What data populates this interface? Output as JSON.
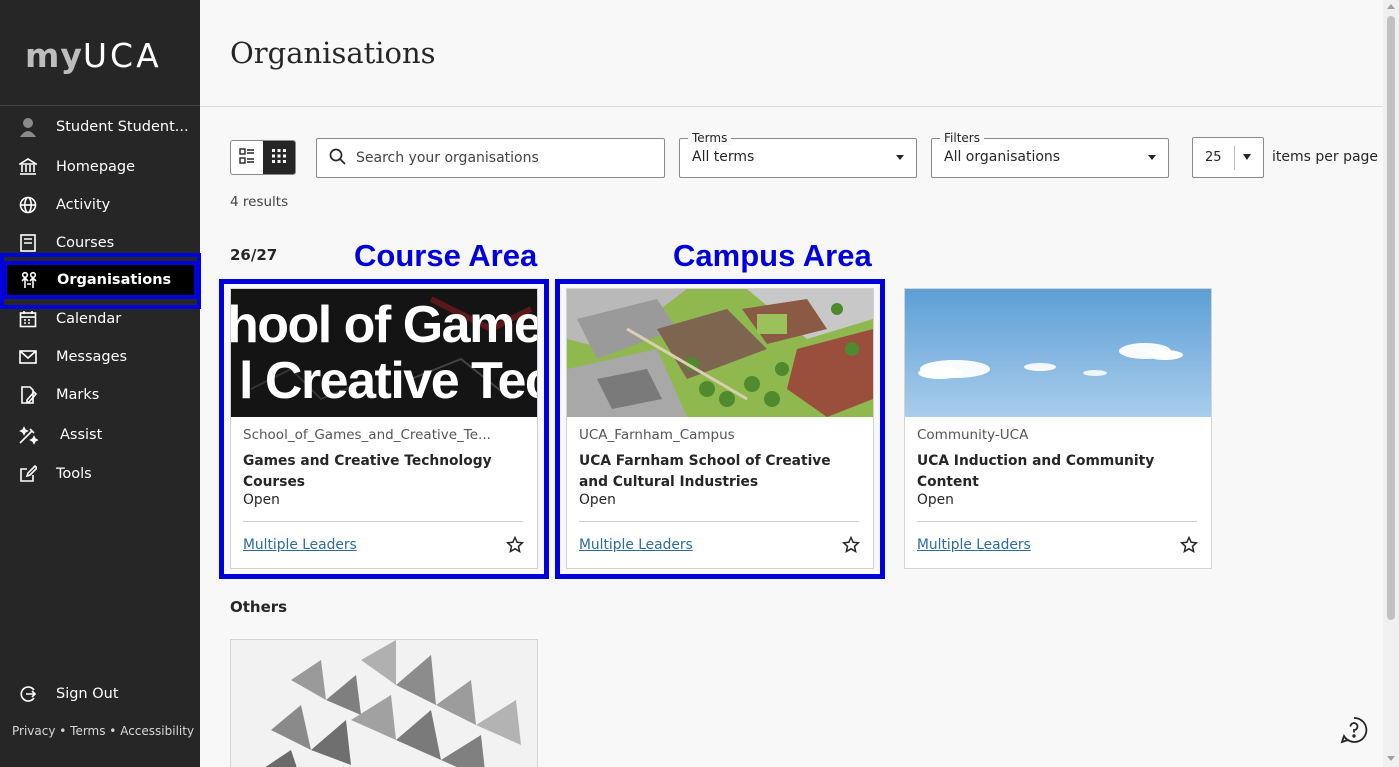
{
  "sidebar": {
    "logo_my": "my",
    "logo_uca": "UCA",
    "user_name": "Student Student...",
    "items": [
      {
        "label": "Homepage",
        "icon": "institution-icon"
      },
      {
        "label": "Activity",
        "icon": "globe-icon"
      },
      {
        "label": "Courses",
        "icon": "book-icon"
      },
      {
        "label": "Organisations",
        "icon": "people-icon",
        "active": true
      },
      {
        "label": "Calendar",
        "icon": "calendar-icon"
      },
      {
        "label": "Messages",
        "icon": "envelope-icon"
      },
      {
        "label": "Marks",
        "icon": "marks-icon"
      },
      {
        "label": "Assist",
        "icon": "assist-icon"
      },
      {
        "label": "Tools",
        "icon": "tools-icon"
      }
    ],
    "sign_out": "Sign Out",
    "footer": "Privacy • Terms • Accessibility"
  },
  "header": {
    "title": "Organisations"
  },
  "toolbar": {
    "search_placeholder": "Search your organisations",
    "terms_legend": "Terms",
    "terms_value": "All terms",
    "filters_legend": "Filters",
    "filters_value": "All organisations",
    "per_page_value": "25",
    "per_page_label": "items per page"
  },
  "results_text": "4 results",
  "term_heading": "26/27",
  "others_heading": "Others",
  "annotations": {
    "course_area": "Course Area",
    "campus_area": "Campus Area",
    "color": "#0000dd"
  },
  "cards": [
    {
      "banner_text_line1": "hool of Games",
      "banner_text_line2": "l Creative Tech",
      "code": "School_of_Games_and_Creative_Te...",
      "name": "Games and Creative Technology Courses",
      "status": "Open",
      "leaders": "Multiple Leaders"
    },
    {
      "code": "UCA_Farnham_Campus",
      "name": "UCA Farnham School of Creative and Cultural Industries",
      "status": "Open",
      "leaders": "Multiple Leaders"
    },
    {
      "code": "Community-UCA",
      "name": "UCA Induction and Community Content",
      "status": "Open",
      "leaders": "Multiple Leaders"
    }
  ]
}
